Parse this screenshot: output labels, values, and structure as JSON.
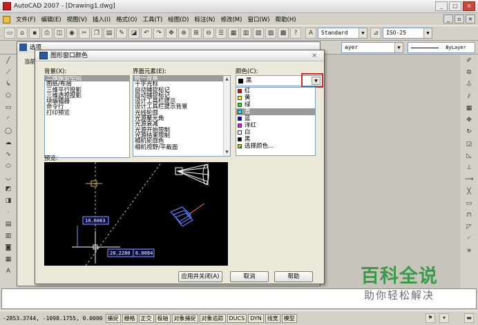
{
  "window": {
    "title": "AutoCAD 2007 - [Drawing1.dwg]",
    "buttons": [
      "_",
      "□",
      "×"
    ]
  },
  "menubar": {
    "items": [
      "文件(F)",
      "编辑(E)",
      "视图(V)",
      "插入(I)",
      "格式(O)",
      "工具(T)",
      "绘图(D)",
      "标注(N)",
      "修改(M)",
      "窗口(W)",
      "帮助(H)"
    ],
    "mdi_buttons": [
      "_",
      "▫",
      "×"
    ]
  },
  "toolbar": {
    "text_style": "Standard",
    "dim_style": "ISO-25",
    "layer_right": "ByLayer",
    "layer_left": "ayer"
  },
  "options_dialog": {
    "title": "选项",
    "current_label": "当前"
  },
  "color_dialog": {
    "title": "图形窗口颜色",
    "context_label": "背景(X):",
    "elements_label": "界面元素(E):",
    "color_label": "颜色(C):",
    "preview_label": "预览:",
    "contexts": [
      "二维模型空间",
      "图纸/布局",
      "三维平行投影",
      "三维透视投影",
      "块编辑器",
      "命令行",
      "打印预览"
    ],
    "elements": [
      "统一背景",
      "十字光标",
      "自动捕捉标记",
      "自动捕捉标记",
      "设计工具栏提示",
      "设计工具栏提示背景",
      "光线轮廓",
      "光源聚光角",
      "光源衰减",
      "光源开始限制",
      "光源结束限制",
      "相机轮廓色",
      "相机视野/平截面"
    ],
    "selected_color": "黑",
    "colors": [
      {
        "name": "红",
        "hex": "#ff0000"
      },
      {
        "name": "黄",
        "hex": "#ffff00"
      },
      {
        "name": "绿",
        "hex": "#00ff00"
      },
      {
        "name": "青",
        "hex": "#00ffff"
      },
      {
        "name": "蓝",
        "hex": "#0000ff"
      },
      {
        "name": "洋红",
        "hex": "#ff00ff"
      },
      {
        "name": "白",
        "hex": "#ffffff"
      },
      {
        "name": "黑",
        "hex": "#000000"
      },
      {
        "name": "选择颜色...",
        "hex": "multicolor"
      }
    ],
    "preview_values": [
      "10.6063",
      "28.2280",
      "6.0084"
    ],
    "buttons": {
      "apply": "应用并关闭(A)",
      "cancel": "取消",
      "help": "帮助"
    }
  },
  "statusbar": {
    "coords": "-2853.3744, -1098.1755, 0.0000",
    "toggles": [
      "捕捉",
      "栅格",
      "正交",
      "极轴",
      "对象捕捉",
      "对象追踪",
      "DUCS",
      "DYN",
      "线宽",
      "模型"
    ]
  },
  "watermark": {
    "main": "百科全说",
    "sub": "助你轻松解决"
  }
}
